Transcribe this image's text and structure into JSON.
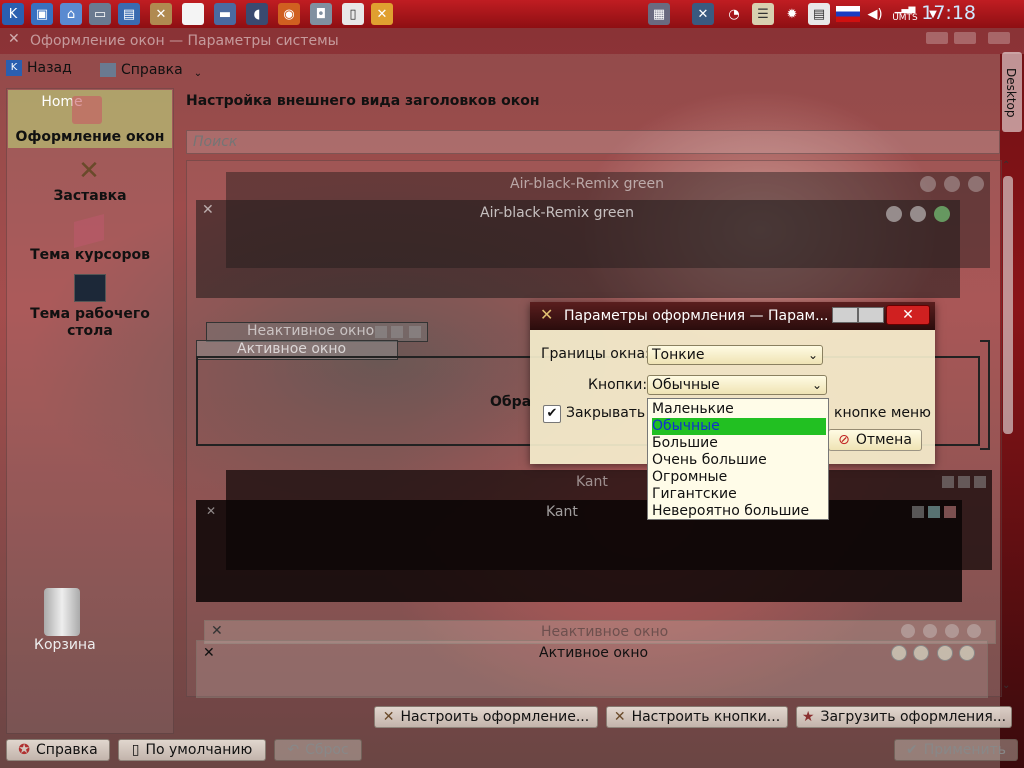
{
  "panel": {
    "clock": "17:18",
    "network_label": "UMTS",
    "icons": [
      "kde-menu-icon",
      "computer-icon",
      "network-icon",
      "drive-icon",
      "monitor-icon",
      "tools-icon",
      "blank-icon",
      "window-icon",
      "chat-icon",
      "firefox-icon",
      "camera-icon",
      "notepad-icon",
      "settings-icon"
    ],
    "tray_icons": [
      "switcher-icon",
      "monitor-tool-icon",
      "swirl-icon",
      "list-icon",
      "gear-icon",
      "clipboard-icon",
      "flag-ru-icon",
      "volume-icon",
      "signal-icon",
      "arrow-down-icon"
    ]
  },
  "window": {
    "title": "Оформление окон — Параметры системы",
    "toolbar": {
      "back": "Назад",
      "help": "Справка"
    }
  },
  "sidebar": {
    "items": [
      {
        "label": "Home"
      },
      {
        "label": "Оформление окон"
      },
      {
        "label": "Заставка"
      },
      {
        "label": "Тема курсоров"
      },
      {
        "label": "Тема рабочего стола"
      }
    ]
  },
  "main": {
    "heading": "Настройка внешнего вида заголовков окон",
    "search_placeholder": "Поиск",
    "previews": [
      {
        "inactive_title": "Air-black-Remix green",
        "active_title": "Air-black-Remix green"
      },
      {
        "inactive_title": "Неактивное окно",
        "active_title": "Активное окно",
        "body_text": "Обра"
      },
      {
        "inactive_title": "Kant",
        "active_title": "Kant"
      },
      {
        "inactive_title": "Неактивное окно",
        "active_title": "Активное окно"
      }
    ],
    "buttons": {
      "configure_decoration": "Настроить оформление...",
      "configure_buttons": "Настроить кнопки...",
      "load_decorations": "Загрузить оформления..."
    }
  },
  "footer": {
    "help": "Справка",
    "defaults": "По умолчанию",
    "reset": "Сброс",
    "apply": "Применить"
  },
  "dialog": {
    "title": "Параметры оформления — Парам...",
    "border_label": "Границы окна:",
    "border_value": "Тонкие",
    "buttons_label": "Кнопки:",
    "buttons_value": "Обычные",
    "checkbox_label_start": "Закрывать о",
    "checkbox_label_end": "кнопке меню",
    "checkbox_checked": true,
    "cancel": "Отмена",
    "options": [
      "Маленькие",
      "Обычные",
      "Большие",
      "Очень большие",
      "Огромные",
      "Гигантские",
      "Невероятно большие"
    ],
    "selected_index": 1
  },
  "desktop": {
    "trash": "Корзина",
    "side_tab": "Desktop"
  },
  "colors": {
    "accent_green": "#22c022",
    "panel_red": "#c01d22",
    "clock": "#cfe8ff"
  }
}
